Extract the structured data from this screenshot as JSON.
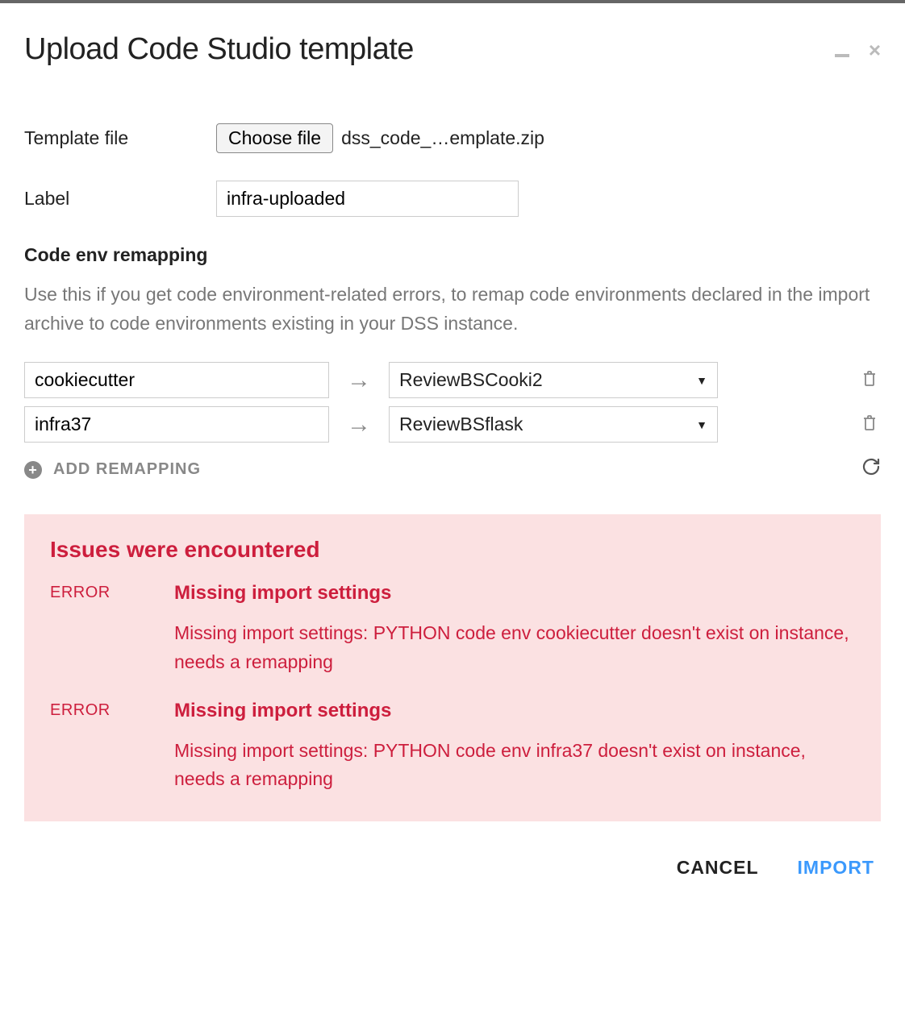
{
  "dialog": {
    "title": "Upload Code Studio template"
  },
  "form": {
    "templateFileLabel": "Template file",
    "chooseFileButton": "Choose file",
    "selectedFilename": "dss_code_…emplate.zip",
    "labelFieldLabel": "Label",
    "labelValue": "infra-uploaded"
  },
  "remapping": {
    "sectionTitle": "Code env remapping",
    "helpText": "Use this if you get code environment-related errors, to remap code environments declared in the import archive to code environments existing in your DSS instance.",
    "rows": [
      {
        "source": "cookiecutter",
        "target": "ReviewBSCooki2"
      },
      {
        "source": "infra37",
        "target": "ReviewBSflask"
      }
    ],
    "addLabel": "ADD REMAPPING"
  },
  "issues": {
    "title": "Issues were encountered",
    "items": [
      {
        "level": "ERROR",
        "heading": "Missing import settings",
        "desc": "Missing import settings: PYTHON code env cookiecutter doesn't exist on instance, needs a remapping"
      },
      {
        "level": "ERROR",
        "heading": "Missing import settings",
        "desc": "Missing import settings: PYTHON code env infra37 doesn't exist on instance, needs a remapping"
      }
    ]
  },
  "footer": {
    "cancel": "CANCEL",
    "import": "IMPORT"
  }
}
